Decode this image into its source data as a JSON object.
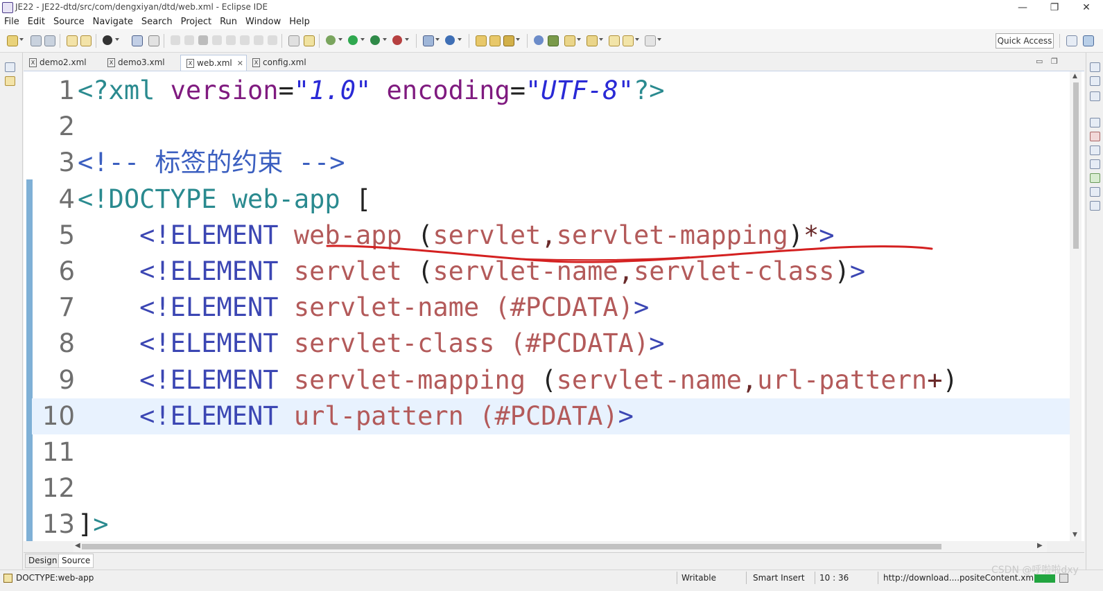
{
  "window": {
    "title": "JE22 - JE22-dtd/src/com/dengxiyan/dtd/web.xml - Eclipse IDE",
    "minimize_glyph": "—",
    "restore_glyph": "❐",
    "close_glyph": "✕"
  },
  "menu": [
    "File",
    "Edit",
    "Source",
    "Navigate",
    "Search",
    "Project",
    "Run",
    "Window",
    "Help"
  ],
  "toolbar": {
    "quick_access": "Quick Access"
  },
  "tabs": [
    {
      "label": "demo2.xml",
      "active": false
    },
    {
      "label": "demo3.xml",
      "active": false
    },
    {
      "label": "web.xml",
      "active": true
    },
    {
      "label": "config.xml",
      "active": false
    }
  ],
  "editor": {
    "file_icon_letter": "X",
    "lines": [
      {
        "num": "1",
        "parts": [
          {
            "t": "<?xml ",
            "c": "c-teal"
          },
          {
            "t": "version",
            "c": "c-purple"
          },
          {
            "t": "=",
            "c": "c-dark"
          },
          {
            "t": "\"1.0\"",
            "c": "c-blue"
          },
          {
            "t": " encoding",
            "c": "c-purple"
          },
          {
            "t": "=",
            "c": "c-dark"
          },
          {
            "t": "\"UTF-8\"",
            "c": "c-blue"
          },
          {
            "t": "?>",
            "c": "c-teal"
          }
        ]
      },
      {
        "num": "2",
        "parts": []
      },
      {
        "num": "3",
        "parts": [
          {
            "t": "<!-- 标签的约束 -->",
            "c": "c-comment"
          }
        ]
      },
      {
        "num": "4",
        "parts": [
          {
            "t": "<!DOCTYPE ",
            "c": "c-teal"
          },
          {
            "t": "web-app ",
            "c": "c-teal"
          },
          {
            "t": "[",
            "c": "c-dark"
          }
        ]
      },
      {
        "num": "5",
        "parts": [
          {
            "t": "    <!ELEMENT ",
            "c": "c-dtd"
          },
          {
            "t": "web-app ",
            "c": "c-name"
          },
          {
            "t": "(",
            "c": "c-dark"
          },
          {
            "t": "servlet",
            "c": "c-name"
          },
          {
            "t": ",",
            "c": "c-op"
          },
          {
            "t": "servlet-mapping",
            "c": "c-name"
          },
          {
            "t": ")",
            "c": "c-dark"
          },
          {
            "t": "*",
            "c": "c-op"
          },
          {
            "t": ">",
            "c": "c-dtd"
          }
        ]
      },
      {
        "num": "6",
        "parts": [
          {
            "t": "    <!ELEMENT ",
            "c": "c-dtd"
          },
          {
            "t": "servlet ",
            "c": "c-name"
          },
          {
            "t": "(",
            "c": "c-dark"
          },
          {
            "t": "servlet-name",
            "c": "c-name"
          },
          {
            "t": ",",
            "c": "c-op"
          },
          {
            "t": "servlet-class",
            "c": "c-name"
          },
          {
            "t": ")",
            "c": "c-dark"
          },
          {
            "t": ">",
            "c": "c-dtd"
          }
        ]
      },
      {
        "num": "7",
        "parts": [
          {
            "t": "    <!ELEMENT ",
            "c": "c-dtd"
          },
          {
            "t": "servlet-name ",
            "c": "c-name"
          },
          {
            "t": "(#PCDATA)",
            "c": "c-name"
          },
          {
            "t": ">",
            "c": "c-dtd"
          }
        ]
      },
      {
        "num": "8",
        "parts": [
          {
            "t": "    <!ELEMENT ",
            "c": "c-dtd"
          },
          {
            "t": "servlet-class ",
            "c": "c-name"
          },
          {
            "t": "(#PCDATA)",
            "c": "c-name"
          },
          {
            "t": ">",
            "c": "c-dtd"
          }
        ]
      },
      {
        "num": "9",
        "parts": [
          {
            "t": "    <!ELEMENT ",
            "c": "c-dtd"
          },
          {
            "t": "servlet-mapping ",
            "c": "c-name"
          },
          {
            "t": "(",
            "c": "c-dark"
          },
          {
            "t": "servlet-name",
            "c": "c-name"
          },
          {
            "t": ",",
            "c": "c-op"
          },
          {
            "t": "url-pattern",
            "c": "c-name"
          },
          {
            "t": "+",
            "c": "c-op"
          },
          {
            "t": ")",
            "c": "c-dark"
          }
        ]
      },
      {
        "num": "10",
        "current": true,
        "parts": [
          {
            "t": "    <!ELEMENT ",
            "c": "c-dtd"
          },
          {
            "t": "url-pattern ",
            "c": "c-name"
          },
          {
            "t": "(#PCDATA)",
            "c": "c-name"
          },
          {
            "t": ">",
            "c": "c-dtd"
          }
        ]
      },
      {
        "num": "11",
        "parts": []
      },
      {
        "num": "12",
        "parts": []
      },
      {
        "num": "13",
        "parts": [
          {
            "t": "]",
            "c": "c-dark"
          },
          {
            "t": ">",
            "c": "c-teal"
          }
        ]
      }
    ]
  },
  "bottom_tabs": {
    "design": "Design",
    "source": "Source"
  },
  "status": {
    "selection": "DOCTYPE:web-app",
    "writable": "Writable",
    "insert_mode": "Smart Insert",
    "position": "10 : 36",
    "progress": "http://download....positeContent.xml"
  },
  "watermark": "CSDN @呼啦啦dxy",
  "colors": {
    "annotation": "#d42020",
    "current_line": "#e8f2fe",
    "change_bar": "#7fb0d6"
  }
}
